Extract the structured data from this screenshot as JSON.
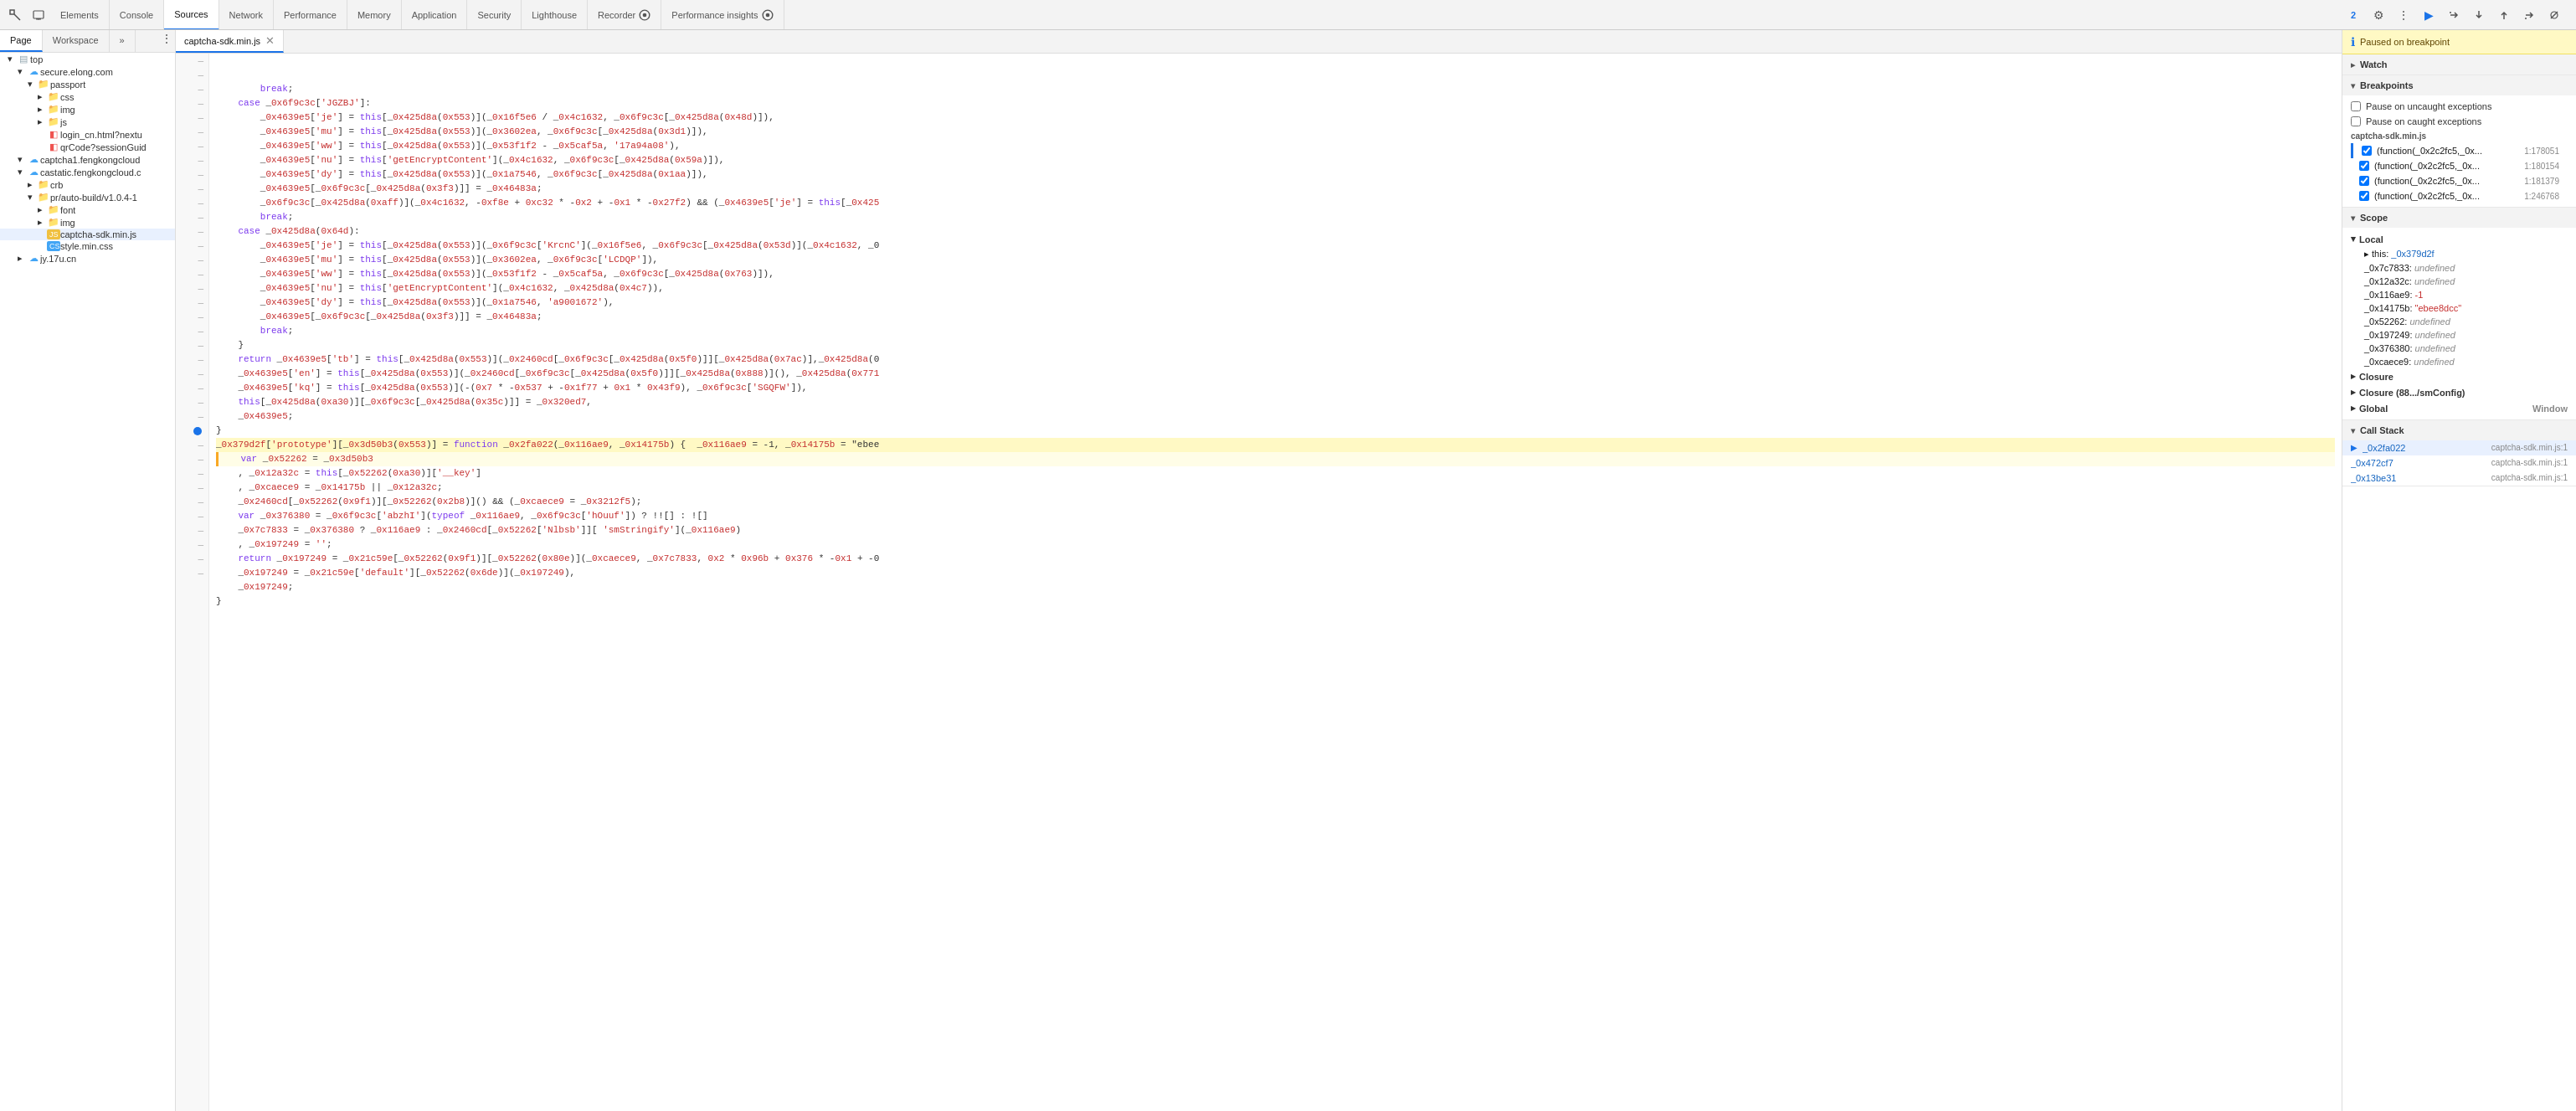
{
  "toolbar": {
    "tabs": [
      {
        "id": "elements",
        "label": "Elements",
        "active": false
      },
      {
        "id": "console",
        "label": "Console",
        "active": false
      },
      {
        "id": "sources",
        "label": "Sources",
        "active": true
      },
      {
        "id": "network",
        "label": "Network",
        "active": false
      },
      {
        "id": "performance",
        "label": "Performance",
        "active": false
      },
      {
        "id": "memory",
        "label": "Memory",
        "active": false
      },
      {
        "id": "application",
        "label": "Application",
        "active": false
      },
      {
        "id": "security",
        "label": "Security",
        "active": false
      },
      {
        "id": "lighthouse",
        "label": "Lighthouse",
        "active": false
      },
      {
        "id": "recorder",
        "label": "Recorder",
        "active": false
      },
      {
        "id": "perf-insights",
        "label": "Performance insights",
        "active": false
      }
    ],
    "badge_count": "2",
    "more_tools_label": "More tools"
  },
  "sources_panel": {
    "subtabs": [
      {
        "id": "page",
        "label": "Page",
        "active": true
      },
      {
        "id": "workspace",
        "label": "Workspace",
        "active": false
      }
    ],
    "file_tab_more": "»"
  },
  "file_tree": {
    "items": [
      {
        "id": "top",
        "label": "top",
        "indent": 1,
        "type": "folder",
        "expanded": true
      },
      {
        "id": "secure-elong",
        "label": "secure.elong.com",
        "indent": 2,
        "type": "domain",
        "expanded": true
      },
      {
        "id": "passport",
        "label": "passport",
        "indent": 3,
        "type": "folder",
        "expanded": true
      },
      {
        "id": "css",
        "label": "css",
        "indent": 4,
        "type": "folder",
        "expanded": false
      },
      {
        "id": "img",
        "label": "img",
        "indent": 4,
        "type": "folder",
        "expanded": false
      },
      {
        "id": "js",
        "label": "js",
        "indent": 4,
        "type": "folder",
        "expanded": false
      },
      {
        "id": "login_cn",
        "label": "login_cn.html?nextu",
        "indent": 4,
        "type": "file-html"
      },
      {
        "id": "qrcode",
        "label": "qrCode?sessionGuid",
        "indent": 4,
        "type": "file-html"
      },
      {
        "id": "captcha1",
        "label": "captcha1.fengkongcloud",
        "indent": 2,
        "type": "domain",
        "expanded": true
      },
      {
        "id": "castatic",
        "label": "castatic.fengkongcloud.c",
        "indent": 2,
        "type": "domain",
        "expanded": true
      },
      {
        "id": "crb",
        "label": "crb",
        "indent": 3,
        "type": "folder",
        "expanded": false
      },
      {
        "id": "pr-auto-build",
        "label": "pr/auto-build/v1.0.4-1",
        "indent": 3,
        "type": "folder",
        "expanded": true
      },
      {
        "id": "font",
        "label": "font",
        "indent": 4,
        "type": "folder",
        "expanded": false
      },
      {
        "id": "img2",
        "label": "img",
        "indent": 4,
        "type": "folder",
        "expanded": false
      },
      {
        "id": "captcha-sdk-min-js",
        "label": "captcha-sdk.min.js",
        "indent": 4,
        "type": "file-js",
        "selected": true
      },
      {
        "id": "style-min-css",
        "label": "style.min.css",
        "indent": 4,
        "type": "file-css"
      },
      {
        "id": "jy-17u-cn",
        "label": "jy.17u.cn",
        "indent": 2,
        "type": "domain",
        "expanded": false
      }
    ]
  },
  "open_file": {
    "name": "captcha-sdk.min.js",
    "tab_label": "captcha-sdk.min.js"
  },
  "code_lines": [
    {
      "num": "",
      "text": "        break;",
      "cls": ""
    },
    {
      "num": "",
      "text": "    case _0x6f9c3c['JGZBJ']:",
      "cls": ""
    },
    {
      "num": "",
      "text": "        _0x4639e5['je'] = this[_0x425d8a(0x553)](_0x16f5e6 / _0x4c1632, _0x6f9c3c[_0x425d8a(0x48d)]),",
      "cls": ""
    },
    {
      "num": "",
      "text": "        _0x4639e5['mu'] = this[_0x425d8a(0x553)](_0x3602ea, _0x6f9c3c[_0x425d8a(0x3d1)]),",
      "cls": ""
    },
    {
      "num": "",
      "text": "        _0x4639e5['ww'] = this[_0x425d8a(0x553)](_0x53f1f2 - _0x5caf5a, '17a94a08'),",
      "cls": ""
    },
    {
      "num": "",
      "text": "        _0x4639e5['nu'] = this['getEncryptContent'](_0x4c1632, _0x6f9c3c[_0x425d8a(0x59a)]),",
      "cls": ""
    },
    {
      "num": "",
      "text": "        _0x4639e5['dy'] = this[_0x425d8a(0x553)](_0x1a7546, _0x6f9c3c[_0x425d8a(0x1aa)]),",
      "cls": ""
    },
    {
      "num": "",
      "text": "        _0x4639e5[_0x6f9c3c[_0x425d8a(0x3f3)]] = _0x46483a;",
      "cls": ""
    },
    {
      "num": "",
      "text": "        _0x6f9c3c[_0x425d8a(0xaff)](_0x4c1632, -0xf8e + 0xc32 * -0x2 + -0x1 * -0x27f2) && (_0x4639e5['je'] = this[_0x425",
      "cls": ""
    },
    {
      "num": "",
      "text": "        break;",
      "cls": ""
    },
    {
      "num": "",
      "text": "    case _0x425d8a(0x64d):",
      "cls": ""
    },
    {
      "num": "",
      "text": "        _0x4639e5['je'] = this[_0x425d8a(0x553)](_0x6f9c3c['KrcnC'](_0x16f5e6, _0x6f9c3c[_0x425d8a(0x53d)](_0x4c1632, _0",
      "cls": ""
    },
    {
      "num": "",
      "text": "        _0x4639e5['mu'] = this[_0x425d8a(0x553)](_0x3602ea, _0x6f9c3c['LCDQP']),",
      "cls": ""
    },
    {
      "num": "",
      "text": "        _0x4639e5['ww'] = this[_0x425d8a(0x553)](_0x53f1f2 - _0x5caf5a, _0x6f9c3c[_0x425d8a(0x763)]),",
      "cls": ""
    },
    {
      "num": "",
      "text": "        _0x4639e5['nu'] = this['getEncryptContent'](_0x4c1632, _0x425d8a(0x4c7)),",
      "cls": ""
    },
    {
      "num": "",
      "text": "        _0x4639e5['dy'] = this[_0x425d8a(0x553)](_0x1a7546, 'a9001672'),",
      "cls": ""
    },
    {
      "num": "",
      "text": "        _0x4639e5[_0x6f9c3c[_0x425d8a(0x3f3)]] = _0x46483a;",
      "cls": ""
    },
    {
      "num": "",
      "text": "        break;",
      "cls": ""
    },
    {
      "num": "",
      "text": "    }",
      "cls": ""
    },
    {
      "num": "",
      "text": "    return _0x4639e5['tb'] = this[_0x425d8a(0x553)](_0x2460cd[_0x6f9c3c[_0x425d8a(0x5f0)]][_0x425d8a(0x7ac)],_0x425d8a(0",
      "cls": ""
    },
    {
      "num": "",
      "text": "    _0x4639e5['en'] = this[_0x425d8a(0x553)](_0x2460cd[_0x6f9c3c[_0x425d8a(0x5f0)]][_0x425d8a(0x888)](), _0x425d8a(0x771",
      "cls": ""
    },
    {
      "num": "",
      "text": "    _0x4639e5['kq'] = this[_0x425d8a(0x553)](-(0x7 * -0x537 + -0x1f77 + 0x1 * 0x43f9), _0x6f9c3c['SGQFW']),",
      "cls": ""
    },
    {
      "num": "",
      "text": "    this[_0x425d8a(0xa30)][_0x6f9c3c[_0x425d8a(0x35c)]] = _0x320ed7,",
      "cls": ""
    },
    {
      "num": "",
      "text": "    _0x4639e5;",
      "cls": ""
    },
    {
      "num": "",
      "text": "}",
      "cls": ""
    },
    {
      "num": "",
      "text": "_0x379d2f['prototype'][_0x3d50b3(0x553)] = function _0x2fa022(_0x116ae9, _0x14175b) {  _0x116ae9 = -1, _0x14175b = \"ebee",
      "cls": "highlighted"
    },
    {
      "num": "",
      "text": "    var _0x52262 = _0x3d50b3",
      "cls": "active-line"
    },
    {
      "num": "",
      "text": "    , _0x12a32c = this[_0x52262(0xa30)]['__key']",
      "cls": ""
    },
    {
      "num": "",
      "text": "    , _0xcaece9 = _0x14175b || _0x12a32c;",
      "cls": ""
    },
    {
      "num": "",
      "text": "    _0x2460cd[_0x52262(0x9f1)][_0x52262(0x2b8)]() && (_0xcaece9 = _0x3212f5);",
      "cls": ""
    },
    {
      "num": "",
      "text": "    var _0x376380 = _0x6f9c3c['abzhI'](typeof _0x116ae9, _0x6f9c3c['hOuuf']) ? !![] : ![]",
      "cls": ""
    },
    {
      "num": "",
      "text": "    _0x7c7833 = _0x376380 ? _0x116ae9 : _0x2460cd[_0x52262['Nlbsb']][ 'smStringify'](_0x116ae9)",
      "cls": ""
    },
    {
      "num": "",
      "text": "    , _0x197249 = '';",
      "cls": ""
    },
    {
      "num": "",
      "text": "    return _0x197249 = _0x21c59e[_0x52262(0x9f1)][_0x52262(0x80e)](_0xcaece9, _0x7c7833, 0x2 * 0x96b + 0x376 * -0x1 + -0",
      "cls": ""
    },
    {
      "num": "",
      "text": "    _0x197249 = _0x21c59e['default'][_0x52262(0x6de)](_0x197249),",
      "cls": ""
    },
    {
      "num": "",
      "text": "    _0x197249;",
      "cls": ""
    },
    {
      "num": "",
      "text": "}",
      "cls": ""
    }
  ],
  "right_panel": {
    "paused_text": "Paused on breakpoint",
    "watch_label": "Watch",
    "breakpoints_label": "Breakpoints",
    "pause_uncaught_label": "Pause on uncaught exceptions",
    "pause_caught_label": "Pause on caught exceptions",
    "current_file_label": "captcha-sdk.min.js",
    "breakpoint_items": [
      {
        "id": "bp1",
        "fn": "(function(_0x2c2fc5,_0x...",
        "loc": "1:178051",
        "checked": true,
        "active": true
      },
      {
        "id": "bp2",
        "fn": "(function(_0x2c2fc5,_0x...",
        "loc": "1:180154",
        "checked": true
      },
      {
        "id": "bp3",
        "fn": "(function(_0x2c2fc5,_0x...",
        "loc": "1:181379",
        "checked": true
      },
      {
        "id": "bp4",
        "fn": "(function(_0x2c2fc5,_0x...",
        "loc": "1:246768",
        "checked": true
      }
    ],
    "scope_label": "Scope",
    "local_label": "Local",
    "this_label": "this",
    "this_value": "_0x379d2f",
    "scope_vars": [
      {
        "key": "_0x7c7833",
        "value": "undefined"
      },
      {
        "key": "_0x12a32c",
        "value": "undefined"
      },
      {
        "key": "_0x116ae9",
        "value": "-1"
      },
      {
        "key": "_0x14175b",
        "value": "\"ebee8dcc\""
      },
      {
        "key": "_0x52262",
        "value": "undefined"
      },
      {
        "key": "_0x197249",
        "value": "undefined"
      },
      {
        "key": "_0x376380",
        "value": "undefined"
      },
      {
        "key": "_0xcaece9",
        "value": "undefined"
      }
    ],
    "closure_label": "Closure",
    "closure2_label": "Closure (88.../smConfig)",
    "global_label": "Global",
    "global_value": "Window",
    "call_stack_label": "Call Stack",
    "call_stack_items": [
      {
        "name": "_0x2fa022",
        "file": "captcha-sdk.min.js:1",
        "active": true
      },
      {
        "name": "_0x472cf7",
        "file": "captcha-sdk.min.js:1"
      },
      {
        "name": "_0x13be31",
        "file": "captcha-sdk.min.js:1"
      }
    ]
  }
}
